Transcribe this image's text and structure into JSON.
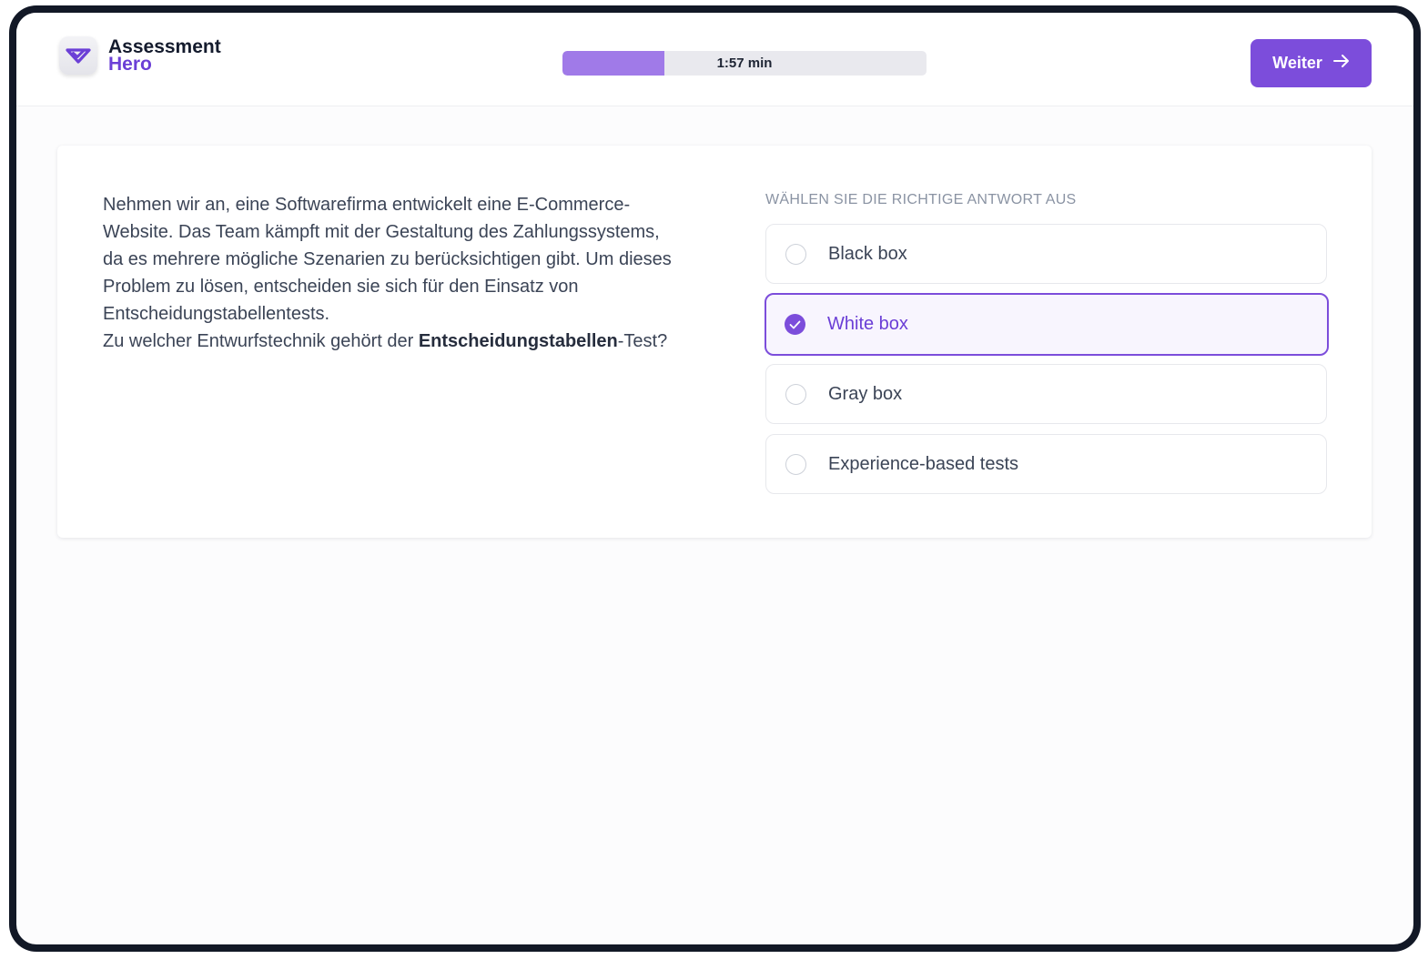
{
  "app": {
    "logo_line1": "Assessment",
    "logo_line2": "Hero",
    "brand_color": "#7c4ddb"
  },
  "timer": {
    "label": "1:57 min",
    "progress_fraction": 0.28
  },
  "toolbar": {
    "next_label": "Weiter",
    "next_icon": "arrow-right-icon"
  },
  "question": {
    "text_part1": "Nehmen wir an, eine Softwarefirma entwickelt eine E-Commerce-Website. Das Team kämpft mit der Gestaltung des Zahlungssystems, da es mehrere mögliche Szenarien zu berücksichtigen gibt. Um dieses Problem zu lösen, entscheiden sie sich für den Einsatz von Entscheidungstabellentests.",
    "text_part2": "Zu welcher Entwurfstechnik gehört der ",
    "text_bold": "Entscheidungstabellen",
    "text_part3": "-Test?"
  },
  "answers": {
    "heading": "WÄHLEN SIE DIE RICHTIGE ANTWORT AUS",
    "options": [
      {
        "label": "Black box",
        "selected": false
      },
      {
        "label": "White box",
        "selected": true
      },
      {
        "label": "Gray box",
        "selected": false
      },
      {
        "label": "Experience-based tests",
        "selected": false
      }
    ]
  }
}
